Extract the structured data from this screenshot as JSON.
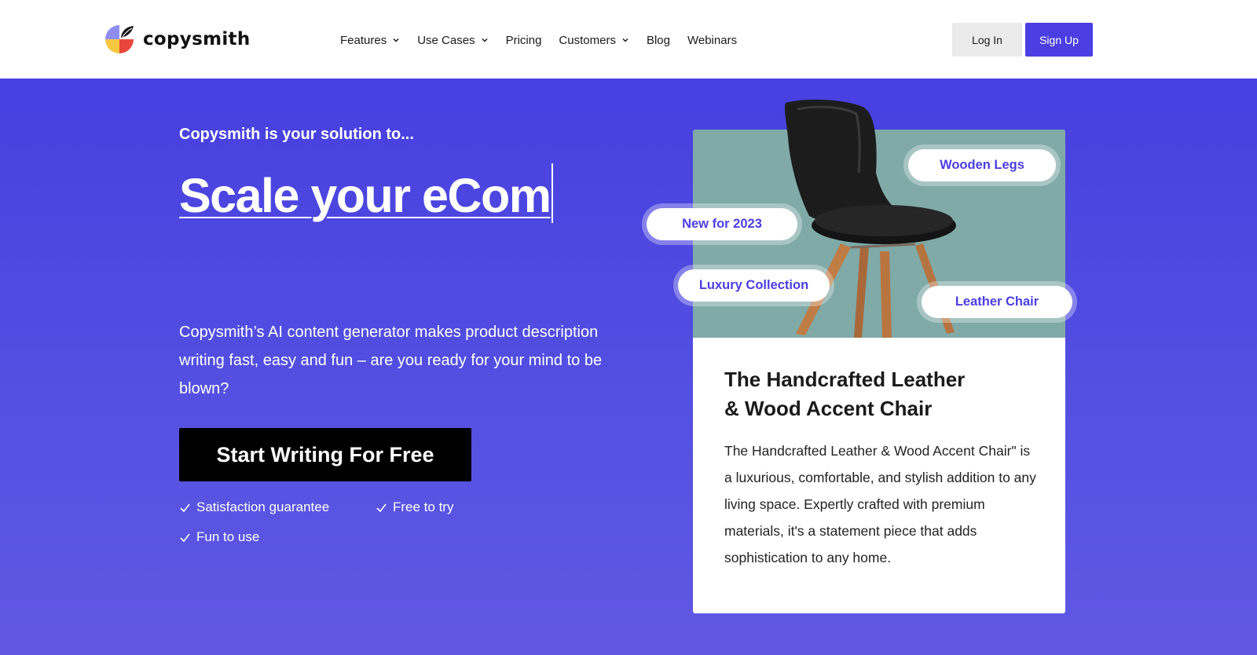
{
  "brand": {
    "name": "copysmith"
  },
  "nav": {
    "items": [
      {
        "label": "Features",
        "dropdown": true
      },
      {
        "label": "Use Cases",
        "dropdown": true
      },
      {
        "label": "Pricing",
        "dropdown": false
      },
      {
        "label": "Customers",
        "dropdown": true
      },
      {
        "label": "Blog",
        "dropdown": false
      },
      {
        "label": "Webinars",
        "dropdown": false
      }
    ],
    "login_label": "Log In",
    "signup_label": "Sign Up"
  },
  "hero": {
    "pretitle": "Copysmith is your solution to...",
    "headline": "Scale your eCom",
    "lede": "Copysmith’s AI content generator makes product description writing fast, easy and fun – are you ready for your mind to be blown?",
    "cta_label": "Start Writing For Free",
    "checks": [
      "Satisfaction guarantee",
      "Free to try",
      "Fun to use"
    ]
  },
  "product_card": {
    "tags": [
      "Wooden Legs",
      "New for 2023",
      "Luxury Collection",
      "Leather Chair"
    ],
    "title_line1": "The Handcrafted Leather",
    "title_line2": "& Wood Accent Chair",
    "description": "The Handcrafted Leather & Wood Accent Chair\" is a luxurious, comfortable, and stylish addition to any living space. Expertly crafted with premium materials, it's a statement piece that adds sophistication to any home."
  },
  "colors": {
    "accent": "#4b3ee3",
    "hero_top": "#473fe0",
    "hero_bottom": "#6058e4",
    "photo_bg": "#7faaa8",
    "cta_bg": "#000000"
  }
}
